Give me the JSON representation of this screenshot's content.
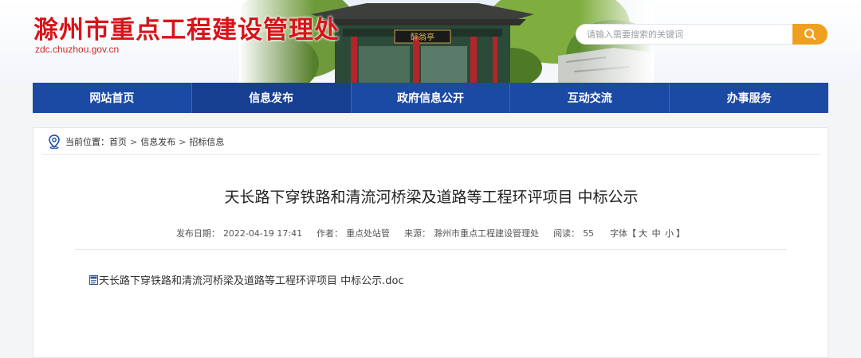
{
  "header": {
    "site_title": "滁州市重点工程建设管理处",
    "site_url": "zdc.chuzhou.gov.cn",
    "pavilion_plaque": "醉翁亭"
  },
  "search": {
    "placeholder": "请输入需要搜索的关键词",
    "button_icon": "search-icon"
  },
  "nav": {
    "items": [
      {
        "label": "网站首页"
      },
      {
        "label": "信息发布"
      },
      {
        "label": "政府信息公开"
      },
      {
        "label": "互动交流"
      },
      {
        "label": "办事服务"
      }
    ],
    "active_index": 1
  },
  "breadcrumb": {
    "prefix": "当前位置：",
    "items": [
      "首页",
      "信息发布",
      "招标信息"
    ],
    "separator": ">"
  },
  "article": {
    "title": "天长路下穿铁路和清流河桥梁及道路等工程环评项目 中标公示",
    "meta": {
      "date_label": "发布日期：",
      "date": "2022-04-19 17:41",
      "author_label": "作者：",
      "author": "重点处站管",
      "source_label": "来源：",
      "source": "滁州市重点工程建设管理处",
      "views_label": "阅读：",
      "views": "55",
      "font_label": "字体【",
      "font_large": "大",
      "font_medium": "中",
      "font_small": "小",
      "font_close": "】"
    },
    "attachment": "天长路下穿铁路和清流河桥梁及道路等工程环评项目 中标公示.doc"
  },
  "colors": {
    "nav_bg": "#1b4aa5",
    "nav_active": "#173f91",
    "title_red": "#d7141a",
    "search_btn": "#f0a020"
  }
}
